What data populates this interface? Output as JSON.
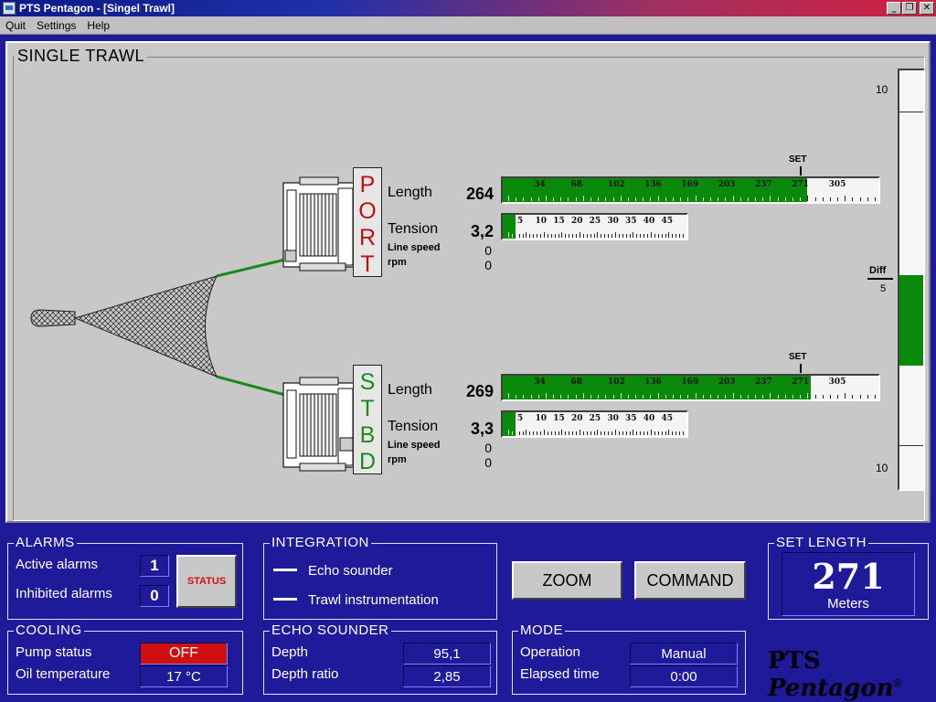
{
  "window": {
    "title": "PTS Pentagon - [Singel Trawl]"
  },
  "menu": {
    "quit": "Quit",
    "settings": "Settings",
    "help": "Help"
  },
  "main": {
    "title": "SINGLE TRAWL"
  },
  "diff": {
    "top": "10",
    "label": "Diff",
    "value": "5",
    "bottom": "10",
    "fill_from_fraction": 0.49,
    "fill_to_fraction": 0.705
  },
  "port": {
    "letters": [
      "P",
      "O",
      "R",
      "T"
    ],
    "length_label": "Length",
    "length_value": "264",
    "tension_label": "Tension",
    "tension_value": "3,2",
    "line_speed_label": "Line speed",
    "line_speed_value": "0",
    "rpm_label": "rpm",
    "rpm_value": "0",
    "set_label": "SET",
    "length_fill_fraction": 0.81,
    "tension_fill_fraction": 0.07
  },
  "stbd": {
    "letters": [
      "S",
      "T",
      "B",
      "D"
    ],
    "length_label": "Length",
    "length_value": "269",
    "tension_label": "Tension",
    "tension_value": "3,3",
    "line_speed_label": "Line speed",
    "line_speed_value": "0",
    "rpm_label": "rpm",
    "rpm_value": "0",
    "set_label": "SET",
    "length_fill_fraction": 0.82,
    "tension_fill_fraction": 0.07
  },
  "length_ticks": [
    "34",
    "68",
    "102",
    "136",
    "169",
    "203",
    "237",
    "271",
    "305"
  ],
  "tension_ticks": [
    "5",
    "10",
    "15",
    "20",
    "25",
    "30",
    "35",
    "40",
    "45"
  ],
  "alarms": {
    "title": "ALARMS",
    "active_label": "Active alarms",
    "active_value": "1",
    "inhibited_label": "Inhibited alarms",
    "inhibited_value": "0",
    "status_button": "STATUS"
  },
  "integration": {
    "title": "INTEGRATION",
    "echo_sounder": "Echo sounder",
    "trawl_instrumentation": "Trawl instrumentation"
  },
  "buttons": {
    "zoom": "ZOOM",
    "command": "COMMAND"
  },
  "set_length": {
    "title": "SET LENGTH",
    "value": "271",
    "unit": "Meters"
  },
  "cooling": {
    "title": "COOLING",
    "pump_label": "Pump status",
    "pump_value": "OFF",
    "oil_label": "Oil temperature",
    "oil_value": "17 °C"
  },
  "echo": {
    "title": "ECHO SOUNDER",
    "depth_label": "Depth",
    "depth_value": "95,1",
    "ratio_label": "Depth ratio",
    "ratio_value": "2,85"
  },
  "mode": {
    "title": "MODE",
    "operation_label": "Operation",
    "operation_value": "Manual",
    "elapsed_label": "Elapsed time",
    "elapsed_value": "0:00"
  },
  "logo": {
    "brand": "PTS",
    "name": "Pentagon",
    "mark": "®"
  },
  "colors": {
    "bar_fill": "#0a8a0a",
    "port": "#c01010",
    "stbd": "#1a8a1a",
    "panel_bg": "#1e1a9a",
    "pump_off": "#d01010"
  }
}
